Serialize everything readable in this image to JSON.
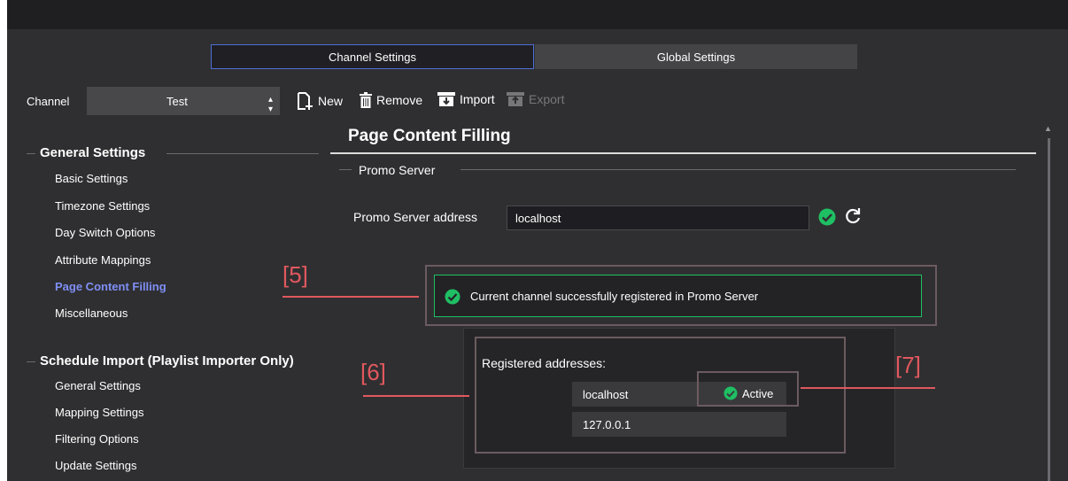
{
  "tabs": [
    {
      "label": "Channel Settings",
      "active": true
    },
    {
      "label": "Global Settings",
      "active": false
    }
  ],
  "toolbar": {
    "channel_label": "Channel",
    "channel_value": "Test",
    "new_label": "New",
    "remove_label": "Remove",
    "import_label": "Import",
    "export_label": "Export"
  },
  "sidebar": {
    "general": {
      "title": "General Settings",
      "items": [
        "Basic Settings",
        "Timezone Settings",
        "Day Switch Options",
        "Attribute Mappings",
        "Page Content Filling",
        "Miscellaneous"
      ],
      "active_item": "Page Content Filling"
    },
    "schedule": {
      "title": "Schedule Import (Playlist Importer Only)",
      "items": [
        "General Settings",
        "Mapping Settings",
        "Filtering Options",
        "Update Settings"
      ]
    }
  },
  "main": {
    "title": "Page Content Filling",
    "group_title": "Promo Server",
    "address_label": "Promo Server address",
    "address_value": "localhost",
    "status_message": "Current channel successfully registered in Promo Server",
    "registered_title": "Registered addresses:",
    "registered": [
      {
        "address": "localhost",
        "status": "Active"
      },
      {
        "address": "127.0.0.1",
        "status": ""
      }
    ]
  },
  "annotations": [
    "[5]",
    "[6]",
    "[7]"
  ],
  "colors": {
    "accent": "#7f8ff5",
    "success": "#1fbf63",
    "annotation": "#e0585e",
    "background": "#2f2f31"
  },
  "icons": [
    "new-page-icon",
    "trash-icon",
    "import-icon",
    "export-icon",
    "check-circle-icon",
    "refresh-icon",
    "dropdown-arrows-icon"
  ]
}
